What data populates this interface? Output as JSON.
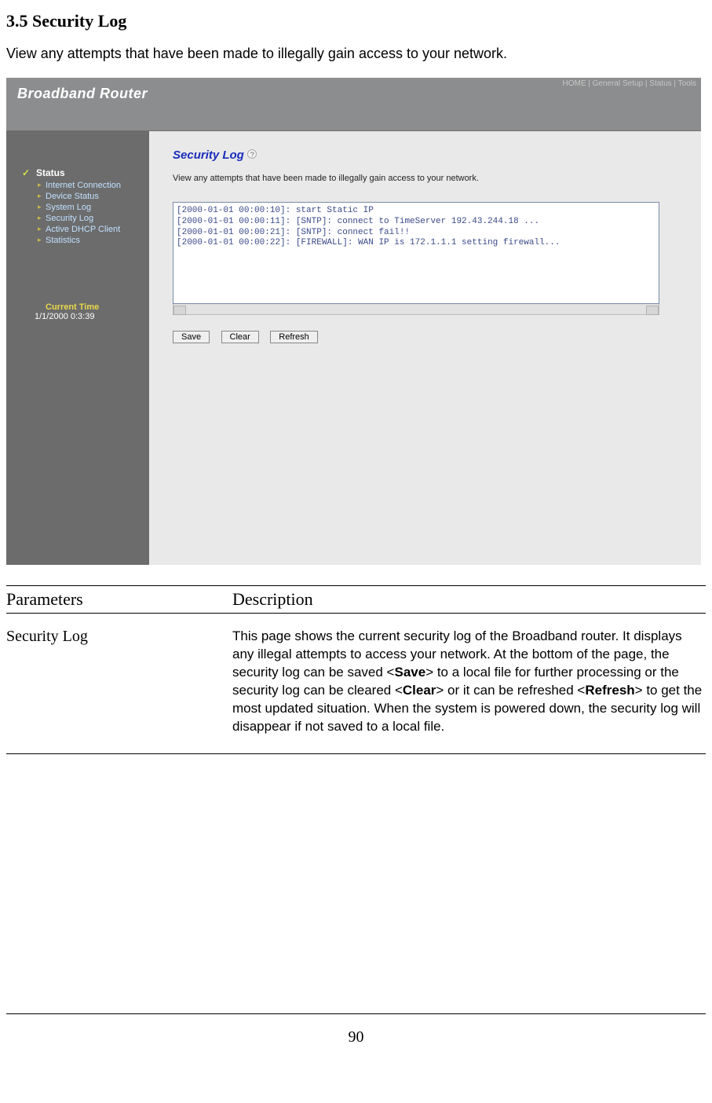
{
  "doc": {
    "heading": "3.5 Security Log",
    "intro": "View any attempts that have been made to illegally gain access to your network.",
    "page_number": "90"
  },
  "screenshot": {
    "brand": "Broadband Router",
    "topnav": {
      "home": "HOME",
      "sep": " | ",
      "general": "General Setup",
      "status": "Status",
      "tools": "Tools"
    },
    "sidebar": {
      "status_label": "Status",
      "items": [
        "Internet Connection",
        "Device Status",
        "System Log",
        "Security Log",
        "Active DHCP Client",
        "Statistics"
      ],
      "current_time_label": "Current Time",
      "current_time_value": "1/1/2000 0:3:39"
    },
    "main": {
      "title": "Security Log",
      "help_glyph": "?",
      "description": "View any attempts that have been made to illegally gain access to your network.",
      "log_lines": "[2000-01-01 00:00:10]: start Static IP\n[2000-01-01 00:00:11]: [SNTP]: connect to TimeServer 192.43.244.18 ...\n[2000-01-01 00:00:21]: [SNTP]: connect fail!!\n[2000-01-01 00:00:22]: [FIREWALL]: WAN IP is 172.1.1.1 setting firewall...",
      "buttons": {
        "save": "Save",
        "clear": "Clear",
        "refresh": "Refresh"
      }
    }
  },
  "params": {
    "col1": "Parameters",
    "col2": "Description",
    "row_name": "Security Log",
    "row_desc_pre": "This page shows the current security log of the Broadband router. It displays any illegal attempts to access your network.\nAt the bottom of the page, the security log can be saved <",
    "b_save": "Save",
    "row_desc_mid1": "> to a local file for further processing or the security log can be cleared  <",
    "b_clear": "Clear",
    "row_desc_mid2": "> or it can be refreshed <",
    "b_refresh": "Refresh",
    "row_desc_post": "> to get the most updated situation. When the system is powered down, the security log will disappear if not saved to a local file."
  }
}
